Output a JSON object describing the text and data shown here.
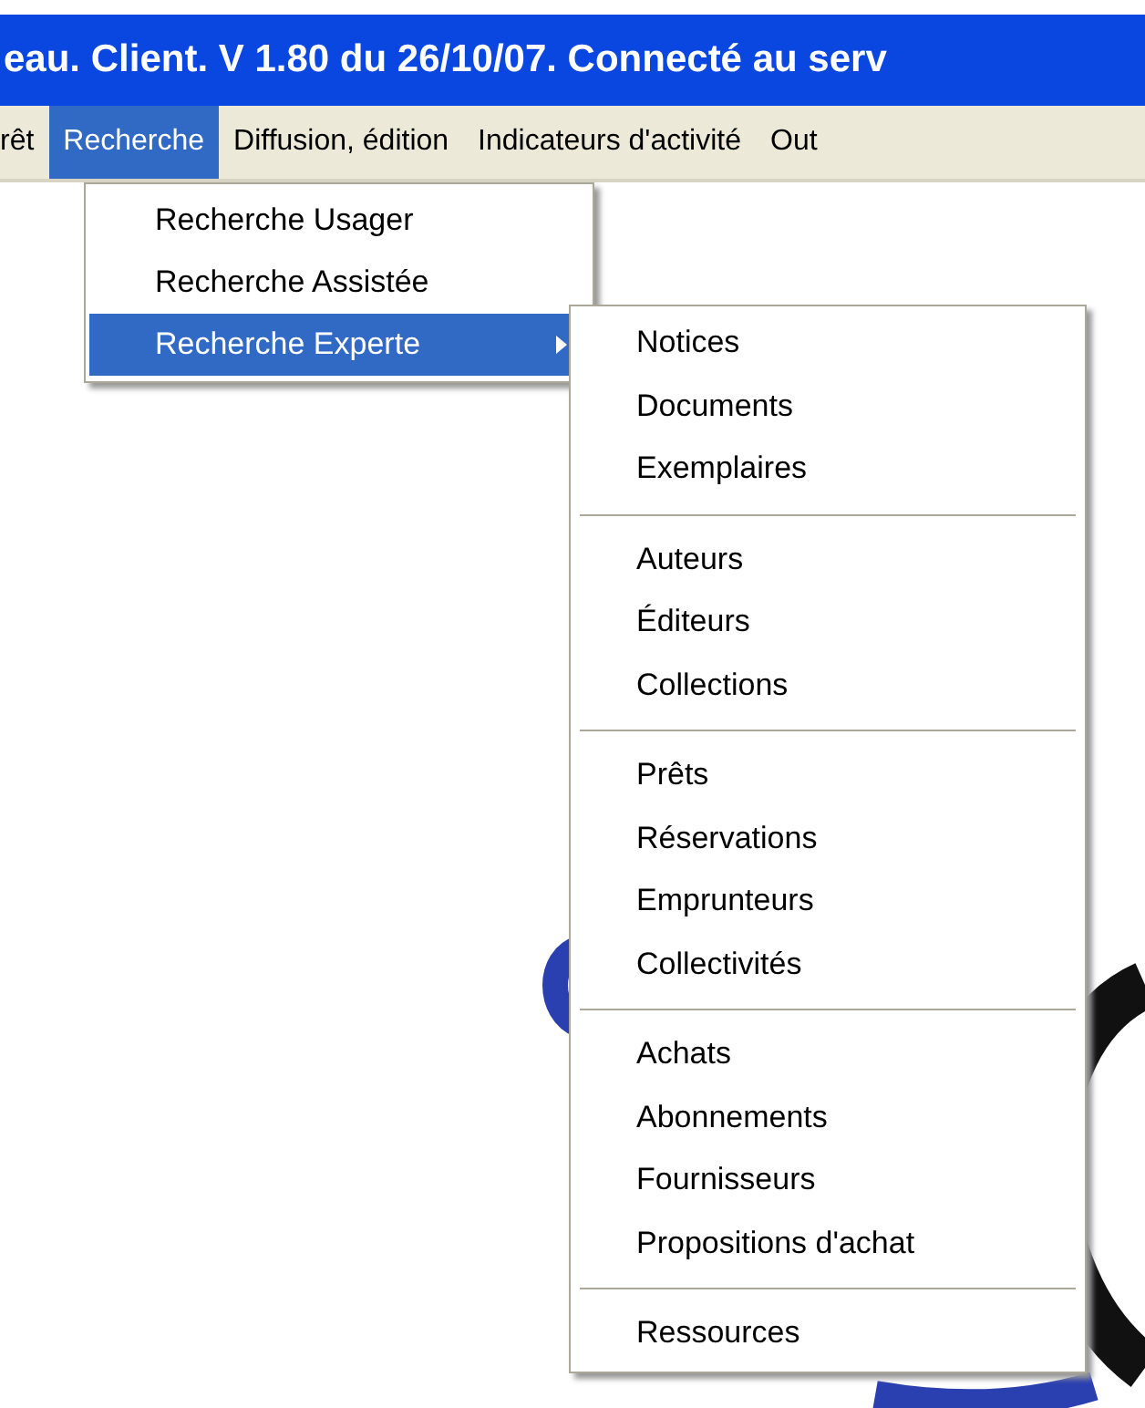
{
  "window": {
    "title": "eau. Client. V 1.80 du 26/10/07. Connecté au serv"
  },
  "menu_bar": [
    {
      "label": "rêt",
      "selected": false
    },
    {
      "label": "Recherche",
      "selected": true
    },
    {
      "label": "Diffusion, édition",
      "selected": false
    },
    {
      "label": "Indicateurs d'activité",
      "selected": false
    },
    {
      "label": "Out",
      "selected": false
    }
  ],
  "dropdown": [
    {
      "label": "Recherche Usager",
      "selected": false,
      "kind": "item"
    },
    {
      "label": "Recherche Assistée",
      "selected": false,
      "kind": "item"
    },
    {
      "label": "Recherche Experte",
      "selected": true,
      "kind": "submenu"
    }
  ],
  "submenu": {
    "groups": [
      {
        "items": [
          "Notices",
          "Documents",
          "Exemplaires"
        ]
      },
      {
        "items": [
          "Auteurs",
          "Éditeurs",
          "Collections"
        ]
      },
      {
        "items": [
          "Prêts",
          "Réservations",
          "Emprunteurs",
          "Collectivités"
        ]
      },
      {
        "items": [
          "Achats",
          "Abonnements",
          "Fournisseurs",
          "Propositions d'achat"
        ]
      },
      {
        "items": [
          "Ressources"
        ]
      }
    ]
  }
}
